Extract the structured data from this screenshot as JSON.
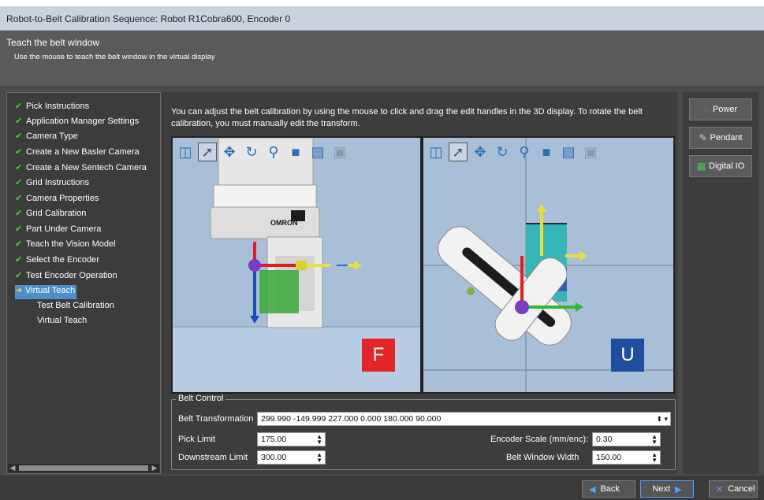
{
  "window": {
    "title": "Robot-to-Belt Calibration Sequence: Robot R1Cobra600, Encoder 0"
  },
  "header": {
    "title": "Teach the belt window",
    "subtitle": "Use the mouse to teach the belt window in the virtual display"
  },
  "steps": [
    {
      "label": "Pick Instructions",
      "state": "done"
    },
    {
      "label": "Application Manager Settings",
      "state": "done"
    },
    {
      "label": "Camera Type",
      "state": "done"
    },
    {
      "label": "Create a New Basler Camera",
      "state": "done"
    },
    {
      "label": "Create a New Sentech Camera",
      "state": "done"
    },
    {
      "label": "Grid Instructions",
      "state": "done"
    },
    {
      "label": "Camera Properties",
      "state": "done"
    },
    {
      "label": "Grid Calibration",
      "state": "done"
    },
    {
      "label": "Part Under Camera",
      "state": "done"
    },
    {
      "label": "Teach the Vision Model",
      "state": "done"
    },
    {
      "label": "Select the Encoder",
      "state": "done"
    },
    {
      "label": "Test Encoder Operation",
      "state": "done"
    },
    {
      "label": "Virtual Teach",
      "state": "current"
    },
    {
      "label": "Test Belt Calibration",
      "state": "pending"
    },
    {
      "label": "Virtual Teach",
      "state": "pending"
    }
  ],
  "main": {
    "instruction": "You can adjust the belt calibration by using the mouse to click and drag the edit handles in the 3D display. To rotate the belt calibration, you must manually edit the transform."
  },
  "viewports": {
    "left_badge": "F",
    "right_badge": "U",
    "robot_logo": "OMRON",
    "colors": {
      "front_badge": "#e3262b",
      "top_badge": "#1f4e9e",
      "background": "#a9bfd7"
    }
  },
  "toolbar_icons": [
    "layout-icon",
    "pointer-icon",
    "move-icon",
    "rotate-icon",
    "probe-icon",
    "cube-icon",
    "list-icon",
    "frame-icon"
  ],
  "belt_control": {
    "legend": "Belt Control",
    "transformation_label": "Belt Transformation",
    "transformation_value": "299.990 -149.999 227.000 0.000 180.000 90.000",
    "pick_limit_label": "Pick Limit",
    "pick_limit_value": "175.00",
    "downstream_limit_label": "Downstream Limit",
    "downstream_limit_value": "300.00",
    "encoder_scale_label": "Encoder Scale (mm/enc):",
    "encoder_scale_value": "0.30",
    "belt_window_width_label": "Belt Window Width",
    "belt_window_width_value": "150.00"
  },
  "side_buttons": {
    "power": "Power",
    "pendant": "Pendant",
    "digital_io": "Digital IO"
  },
  "footer": {
    "back": "Back",
    "next": "Next",
    "cancel": "Cancel"
  }
}
